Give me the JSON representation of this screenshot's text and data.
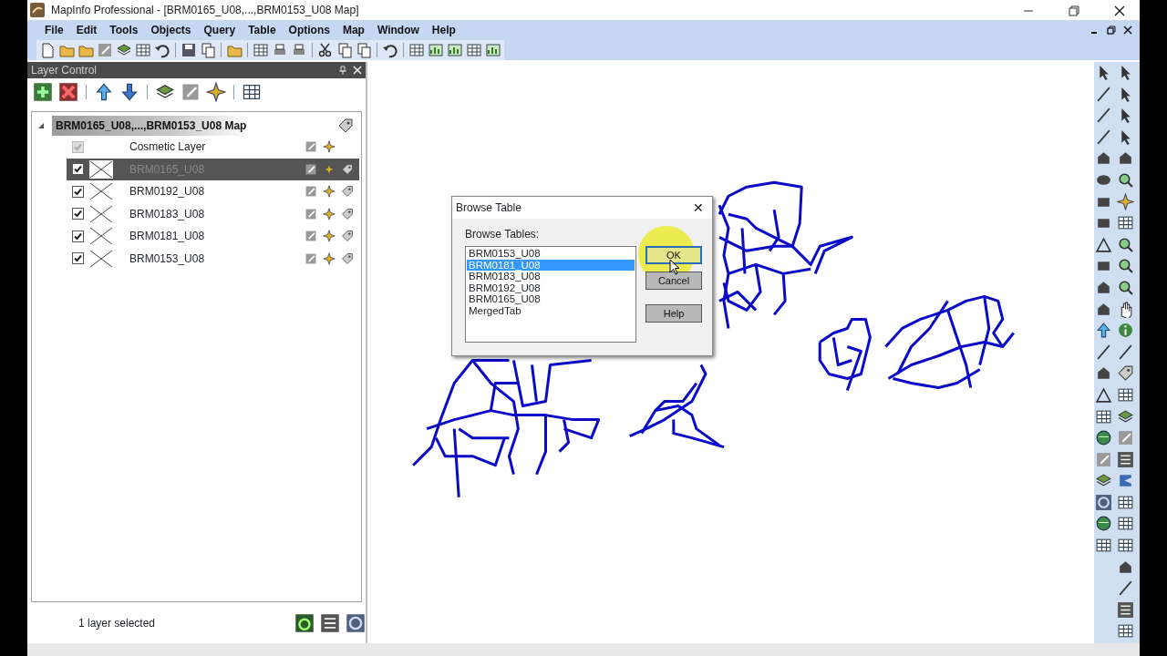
{
  "window": {
    "title": "MapInfo Professional - [BRM0165_U08,...,BRM0153_U08 Map]"
  },
  "menu": [
    "File",
    "Edit",
    "Tools",
    "Objects",
    "Query",
    "Table",
    "Options",
    "Map",
    "Window",
    "Help"
  ],
  "layer_control": {
    "title": "Layer Control",
    "map_name": "BRM0165_U08,...,BRM0153_U08 Map",
    "expanded": true,
    "layers": [
      {
        "name": "Cosmetic Layer",
        "kind": "cosmetic",
        "checked": true,
        "disabled": true,
        "selected": false
      },
      {
        "name": "BRM0165_U08",
        "kind": "table",
        "checked": true,
        "disabled": false,
        "selected": true
      },
      {
        "name": "BRM0192_U08",
        "kind": "table",
        "checked": true,
        "disabled": false,
        "selected": false
      },
      {
        "name": "BRM0183_U08",
        "kind": "table",
        "checked": true,
        "disabled": false,
        "selected": false
      },
      {
        "name": "BRM0181_U08",
        "kind": "table",
        "checked": true,
        "disabled": false,
        "selected": false
      },
      {
        "name": "BRM0153_U08",
        "kind": "table",
        "checked": true,
        "disabled": false,
        "selected": false
      }
    ],
    "status": "1 layer selected"
  },
  "dialog": {
    "title": "Browse Table",
    "close": "✕",
    "list_label": "Browse Tables:",
    "tables": [
      {
        "label": "BRM0153_U08",
        "selected": false
      },
      {
        "label": "BRM0181_U08",
        "selected": true
      },
      {
        "label": "BRM0183_U08",
        "selected": false
      },
      {
        "label": "BRM0192_U08",
        "selected": false
      },
      {
        "label": "BRM0165_U08",
        "selected": false
      },
      {
        "label": "MergedTab",
        "selected": false
      }
    ],
    "buttons": [
      "OK",
      "Cancel",
      "Help"
    ]
  }
}
